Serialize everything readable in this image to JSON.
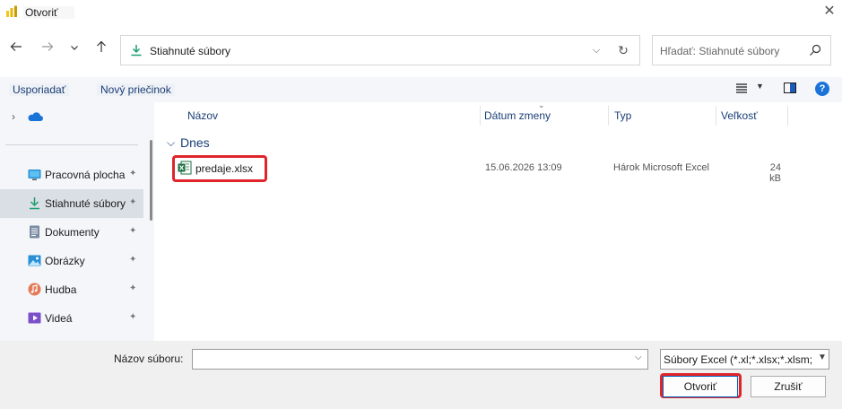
{
  "window": {
    "title": "Otvoriť"
  },
  "nav": {
    "back_icon": "arrow-left-icon",
    "forward_icon": "arrow-right-icon",
    "recent_icon": "chevron-down-icon",
    "up_icon": "arrow-up-icon"
  },
  "address": {
    "path": "Stiahnuté súbory"
  },
  "search": {
    "placeholder": "Hľadať: Stiahnuté súbory"
  },
  "toolbar": {
    "organize_label": "Usporiadať",
    "new_folder_label": "Nový priečinok"
  },
  "sidebar": {
    "items": [
      {
        "label": "Pracovná plocha",
        "icon": "desktop-icon"
      },
      {
        "label": "Stiahnuté súbory",
        "icon": "download-icon",
        "selected": true
      },
      {
        "label": "Dokumenty",
        "icon": "document-icon"
      },
      {
        "label": "Obrázky",
        "icon": "pictures-icon"
      },
      {
        "label": "Hudba",
        "icon": "music-icon"
      },
      {
        "label": "Videá",
        "icon": "video-icon"
      }
    ]
  },
  "list": {
    "columns": {
      "name": "Názov",
      "date": "Dátum zmeny",
      "type": "Typ",
      "size": "Veľkosť"
    },
    "group": "Dnes",
    "files": [
      {
        "name": "predaje.xlsx",
        "date": "15.06.2026 13:09",
        "type": "Hárok Microsoft Excel",
        "size": "24 kB"
      }
    ]
  },
  "bottom": {
    "filename_label": "Názov súboru:",
    "filename_value": "",
    "filter": "Súbory Excel (*.xl;*.xlsx;*.xlsm;",
    "open_label": "Otvoriť",
    "cancel_label": "Zrušiť"
  },
  "colors": {
    "highlight": "#e0242b",
    "accent": "#1a73d9",
    "link": "#1a3e75"
  }
}
